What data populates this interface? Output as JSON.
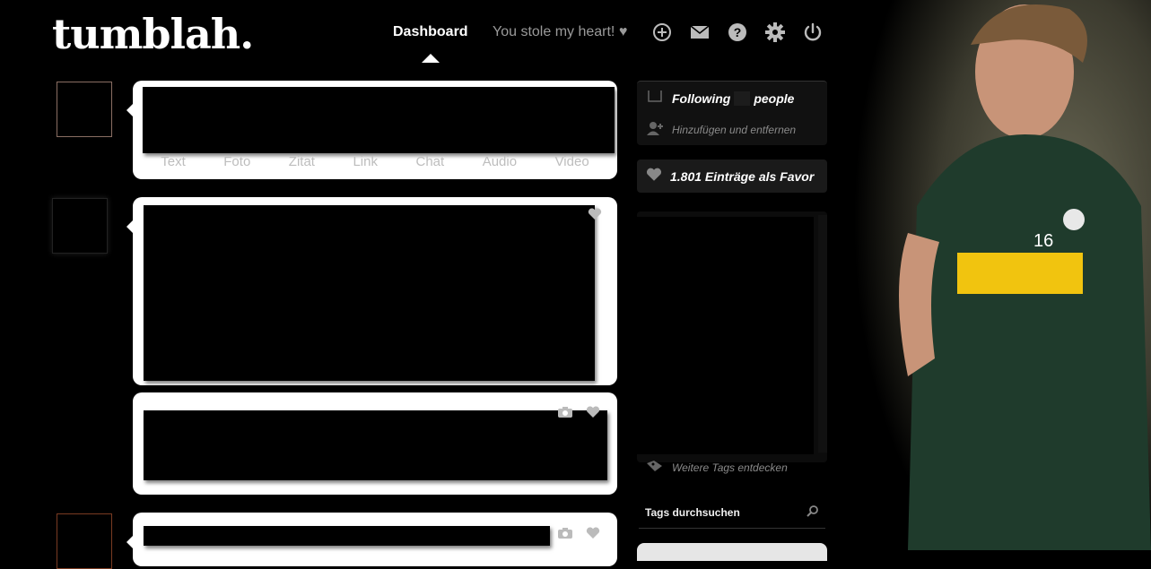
{
  "header": {
    "logo": "tumblah.",
    "nav_dashboard": "Dashboard",
    "nav_blog": "You stole my heart! ♥",
    "icons": [
      "plus-circle-icon",
      "mail-icon",
      "help-icon",
      "gear-icon",
      "power-icon"
    ]
  },
  "composer": {
    "tabs": [
      "Text",
      "Foto",
      "Zitat",
      "Link",
      "Chat",
      "Audio",
      "Video"
    ]
  },
  "sidebar": {
    "following_prefix": "Following",
    "following_suffix": "people",
    "add_remove": "Hinzufügen und entfernen",
    "likes": "1.801 Einträge als Favor",
    "more_tags": "Weitere Tags entdecken",
    "search_label": "Tags durchsuchen"
  },
  "colors": {
    "background": "#000000",
    "card": "#ffffff",
    "muted_text": "#9a9a9a"
  }
}
